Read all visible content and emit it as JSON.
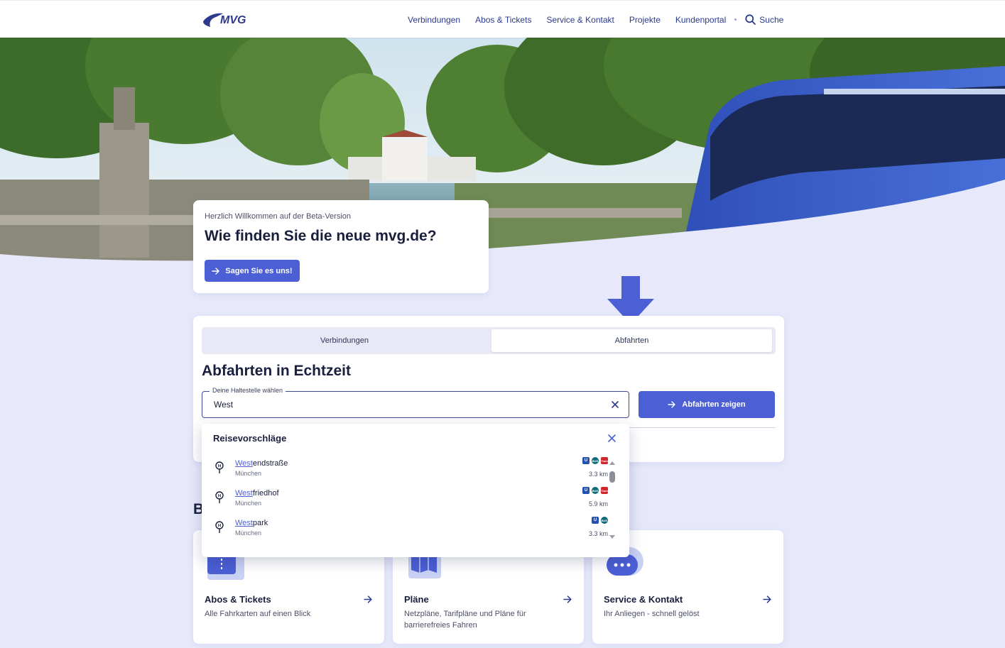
{
  "header": {
    "logo_text": "MVG",
    "nav": [
      "Verbindungen",
      "Abos & Tickets",
      "Service & Kontakt",
      "Projekte",
      "Kundenportal"
    ],
    "search_label": "Suche"
  },
  "beta": {
    "subtitle": "Herzlich Willkommen auf der Beta-Version",
    "title": "Wie finden Sie die neue mvg.de?",
    "button": "Sagen Sie es uns!"
  },
  "departures": {
    "tabs": [
      "Verbindungen",
      "Abfahrten"
    ],
    "active_tab": "Abfahrten",
    "title": "Abfahrten in Echtzeit",
    "field_label": "Deine Haltestelle wählen",
    "field_value": "West",
    "button": "Abfahrten zeigen"
  },
  "suggestions": {
    "title": "Reisevorschläge",
    "items": [
      {
        "match": "West",
        "rest": "endstraße",
        "city": "München",
        "distance": "3.3 km",
        "lines": [
          "U",
          "BUS",
          "Tram"
        ]
      },
      {
        "match": "West",
        "rest": "friedhof",
        "city": "München",
        "distance": "5.9 km",
        "lines": [
          "U",
          "BUS",
          "Tram"
        ]
      },
      {
        "match": "West",
        "rest": "park",
        "city": "München",
        "distance": "3.3 km",
        "lines": [
          "U",
          "BUS"
        ]
      }
    ]
  },
  "section_heading": "B",
  "tiles": [
    {
      "title": "Abos & Tickets",
      "desc": "Alle Fahrkarten auf einen Blick",
      "icon": "ticket-icon"
    },
    {
      "title": "Pläne",
      "desc": "Netzpläne, Tarifpläne und Pläne für barrierefreies Fahren",
      "icon": "map-icon"
    },
    {
      "title": "Service & Kontakt",
      "desc": "Ihr Anliegen - schnell gelöst",
      "icon": "chat-icon"
    }
  ],
  "colors": {
    "brand": "#4c5fd5",
    "navy": "#2b3a8c",
    "background": "#e7e9fb"
  }
}
